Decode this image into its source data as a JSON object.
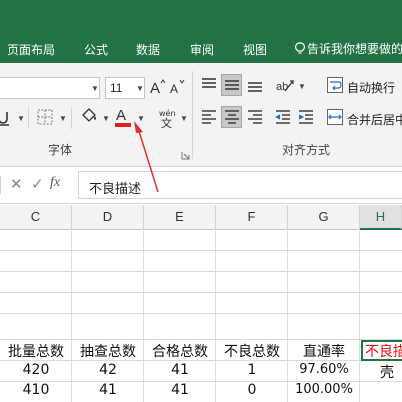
{
  "colors": {
    "ribbon_green": "#217346",
    "font_color_red": "#e0201b",
    "annotation_arrow": "#e03030"
  },
  "tabs": [
    "页面布局",
    "公式",
    "数据",
    "审阅",
    "视图"
  ],
  "tell_me": "告诉我你想要做的",
  "font": {
    "size": "11"
  },
  "font_color_glyph": "A",
  "phonetic_glyph": "wén",
  "groups": {
    "font": "字体",
    "alignment": "对齐方式"
  },
  "alignment": {
    "wrap_text": "自动换行",
    "merge_center": "合并后居中"
  },
  "formula_bar": {
    "fx": "fx",
    "content": "不良描述"
  },
  "columns": [
    "C",
    "D",
    "E",
    "F",
    "G",
    "H"
  ],
  "header_row": [
    "批量总数",
    "抽查总数",
    "合格总数",
    "不良总数",
    "直通率",
    "不良描"
  ],
  "rows": [
    [
      "420",
      "42",
      "41",
      "1",
      "97.60%",
      "壳"
    ],
    [
      "410",
      "41",
      "41",
      "0",
      "100.00%",
      ""
    ]
  ]
}
